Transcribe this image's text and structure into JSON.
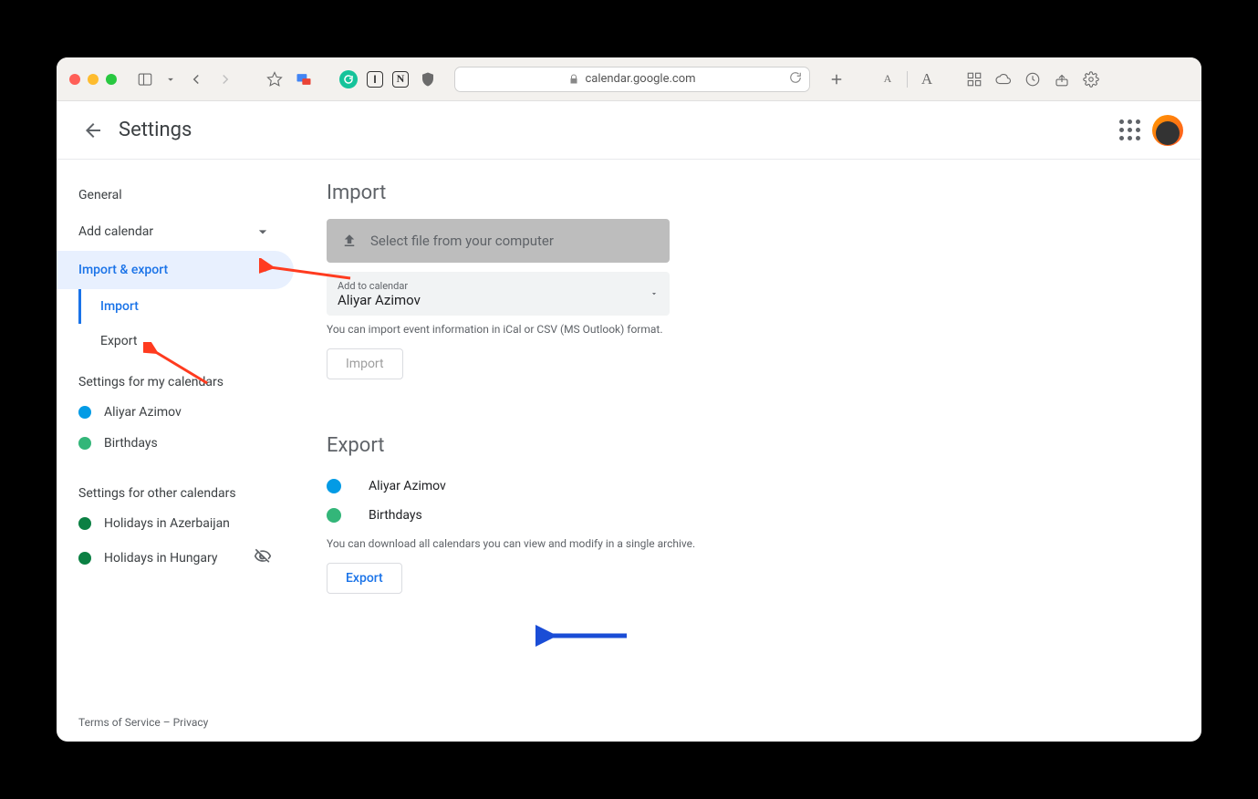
{
  "browser": {
    "url": "calendar.google.com"
  },
  "header": {
    "title": "Settings"
  },
  "sidebar": {
    "general": "General",
    "add_calendar": "Add calendar",
    "import_export": "Import & export",
    "sub_import": "Import",
    "sub_export": "Export",
    "my_calendars_label": "Settings for my calendars",
    "my_calendars": [
      {
        "name": "Aliyar Azimov",
        "color": "#039be5"
      },
      {
        "name": "Birthdays",
        "color": "#33b679"
      }
    ],
    "other_calendars_label": "Settings for other calendars",
    "other_calendars": [
      {
        "name": "Holidays in Azerbaijan",
        "color": "#0b8043",
        "hidden": false
      },
      {
        "name": "Holidays in Hungary",
        "color": "#0b8043",
        "hidden": true
      }
    ]
  },
  "main": {
    "import": {
      "title": "Import",
      "select_file": "Select file from your computer",
      "add_to_calendar_label": "Add to calendar",
      "add_to_calendar_value": "Aliyar Azimov",
      "help": "You can import event information in iCal or CSV (MS Outlook) format.",
      "button": "Import"
    },
    "export": {
      "title": "Export",
      "calendars": [
        {
          "name": "Aliyar Azimov",
          "color": "#039be5"
        },
        {
          "name": "Birthdays",
          "color": "#33b679"
        }
      ],
      "help": "You can download all calendars you can view and modify in a single archive.",
      "button": "Export"
    }
  },
  "footer": {
    "terms": "Terms of Service",
    "sep": " – ",
    "privacy": "Privacy"
  }
}
